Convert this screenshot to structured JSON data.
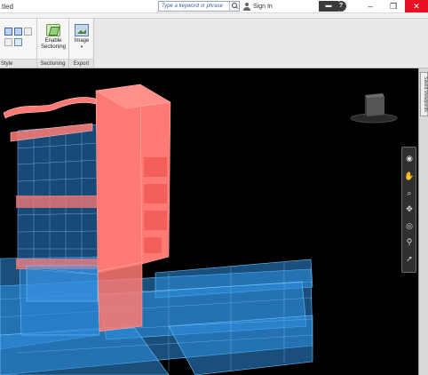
{
  "titlebar": {
    "title": "tled",
    "search_placeholder": "Type a keyword or phrase",
    "sign_in": "Sign In",
    "help": "?",
    "minimize": "–",
    "maximize": "❐",
    "close": "✕"
  },
  "ribbon": {
    "panels": {
      "style": {
        "caption": "Style"
      },
      "sectioning": {
        "caption": "Sectioning",
        "button_label_1": "Enable",
        "button_label_2": "Sectioning"
      },
      "export": {
        "caption": "Export",
        "button_label": "Image",
        "caret": "▾"
      }
    }
  },
  "viewport": {
    "saved_viewpoints_tab": "Saved Viewpoints"
  },
  "navbar": {
    "tools": [
      "steering-wheel-icon",
      "pan-hand-icon",
      "zoom-window-icon",
      "orbit-icon",
      "look-icon",
      "walk-icon",
      "select-icon"
    ]
  },
  "colors": {
    "highlight": "#ff6f6f",
    "glass": "#3aa3ff",
    "background": "#000000",
    "close": "#e81123"
  }
}
